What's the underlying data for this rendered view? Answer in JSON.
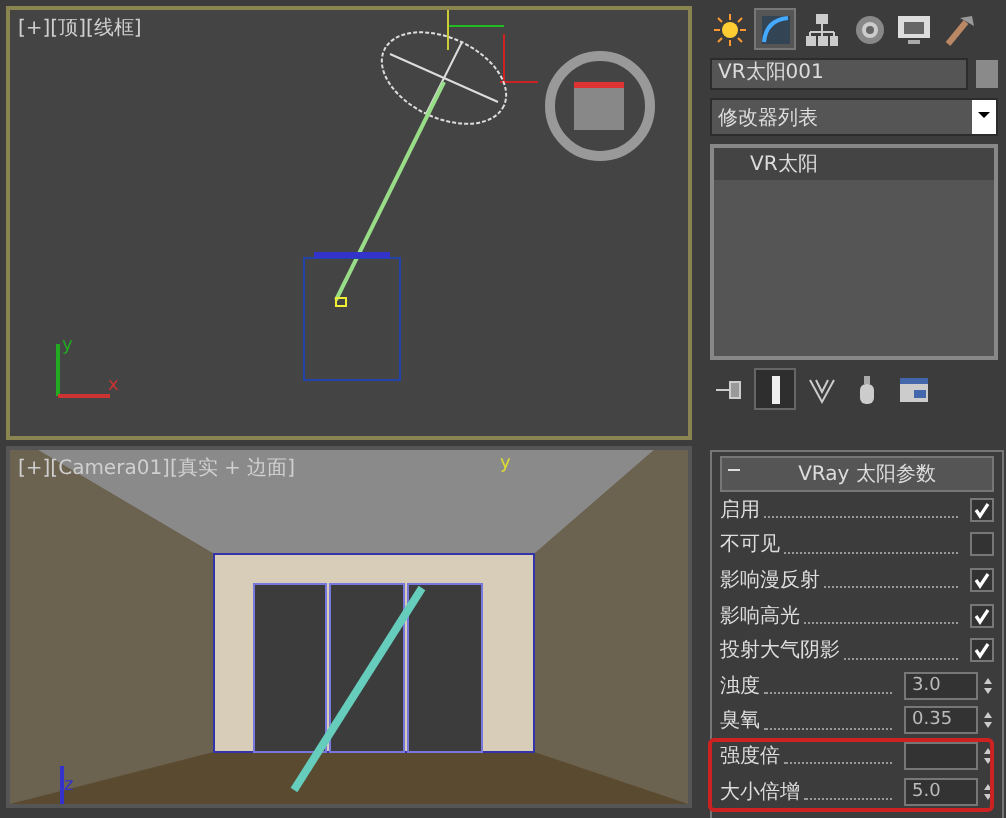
{
  "viewports": [
    {
      "label": "[+][顶][线框]",
      "active": true,
      "kind": "top",
      "axis_labels": [
        "y",
        "x"
      ]
    },
    {
      "label": "[+][Camera01][真实 + 边面]",
      "active": false,
      "kind": "camera",
      "axis_labels": [
        "y",
        "z"
      ]
    }
  ],
  "command_panel": {
    "tabs": [
      {
        "kind": "create",
        "selected": false
      },
      {
        "kind": "modify",
        "selected": true
      },
      {
        "kind": "hierarchy",
        "selected": false
      },
      {
        "kind": "motion",
        "selected": false
      },
      {
        "kind": "display",
        "selected": false
      },
      {
        "kind": "utilities",
        "selected": false
      }
    ],
    "object_name": "VR太阳001",
    "modifier_list": "修改器列表",
    "stack": [
      {
        "label": "VR太阳",
        "selected": true
      }
    ],
    "stack_tools": [
      {
        "kind": "pin",
        "selected": false
      },
      {
        "kind": "show-end",
        "selected": true
      },
      {
        "kind": "unique",
        "selected": false
      },
      {
        "kind": "remove",
        "selected": false
      },
      {
        "kind": "configure",
        "selected": false
      }
    ],
    "rollout": {
      "title": "VRay 太阳参数",
      "expanded": true,
      "params": [
        {
          "kind": "checkbox",
          "label": "启用",
          "checked": true
        },
        {
          "kind": "checkbox",
          "label": "不可见",
          "checked": false
        },
        {
          "kind": "checkbox",
          "label": "影响漫反射",
          "checked": true
        },
        {
          "kind": "checkbox",
          "label": "影响高光",
          "checked": true
        },
        {
          "kind": "checkbox",
          "label": "投射大气阴影",
          "checked": true
        },
        {
          "kind": "spinner",
          "label": "浊度",
          "value": "3.0"
        },
        {
          "kind": "spinner",
          "label": "臭氧",
          "value": "0.35"
        },
        {
          "kind": "spinner",
          "label": "强度倍"
        },
        {
          "kind": "spinner",
          "label": "大小倍增",
          "value": "5.0"
        }
      ]
    }
  },
  "annotation": {
    "kind": "highlight-box"
  }
}
